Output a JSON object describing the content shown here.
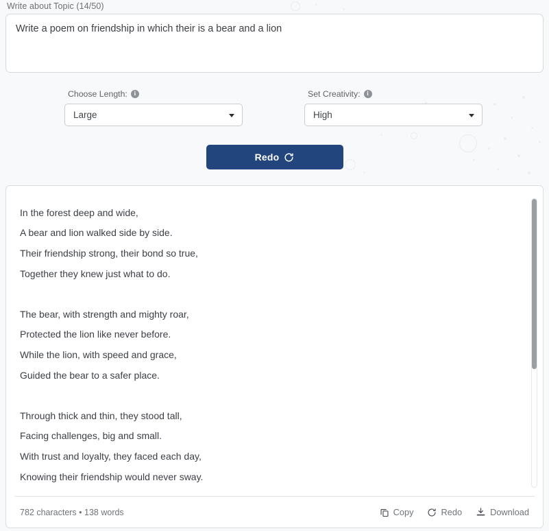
{
  "topic": {
    "label": "Write about Topic (14/50)",
    "value": "Write a poem on friendship in which their is a bear and a lion",
    "placeholder": "Write about Topic"
  },
  "controls": {
    "length": {
      "label": "Choose Length:",
      "info_icon": "info-icon",
      "value": "Large",
      "caret_icon": "chevron-down-icon"
    },
    "creativity": {
      "label": "Set Creativity:",
      "info_icon": "info-icon",
      "value": "High",
      "caret_icon": "chevron-down-icon"
    }
  },
  "primary_action": {
    "label": "Redo",
    "icon": "redo-circular-arrow-icon",
    "background_color": "#21457c",
    "text_color": "#ffffff"
  },
  "output": {
    "lines": [
      "In the forest deep and wide,",
      "A bear and lion walked side by side.",
      "Their friendship strong, their bond so true,",
      "Together they knew just what to do.",
      "",
      "The bear, with strength and mighty roar,",
      "Protected the lion like never before.",
      "While the lion, with speed and grace,",
      "Guided the bear to a safer place.",
      "",
      "Through thick and thin, they stood tall,",
      "Facing challenges, big and small.",
      "With trust and loyalty, they faced each day,",
      "Knowing their friendship would never sway."
    ],
    "scrollbar": {
      "name": "vertical-scrollbar"
    },
    "footer": {
      "counts": "782 characters • 138 words",
      "actions": [
        {
          "label": "Copy",
          "icon": "copy-icon"
        },
        {
          "label": "Redo",
          "icon": "redo-circular-arrow-icon"
        },
        {
          "label": "Download",
          "icon": "download-icon"
        }
      ]
    }
  },
  "theme": {
    "page_background": "#f7f9fa",
    "panel_background": "#ffffff",
    "accent": "#21457c",
    "muted_text": "#6f7479"
  }
}
